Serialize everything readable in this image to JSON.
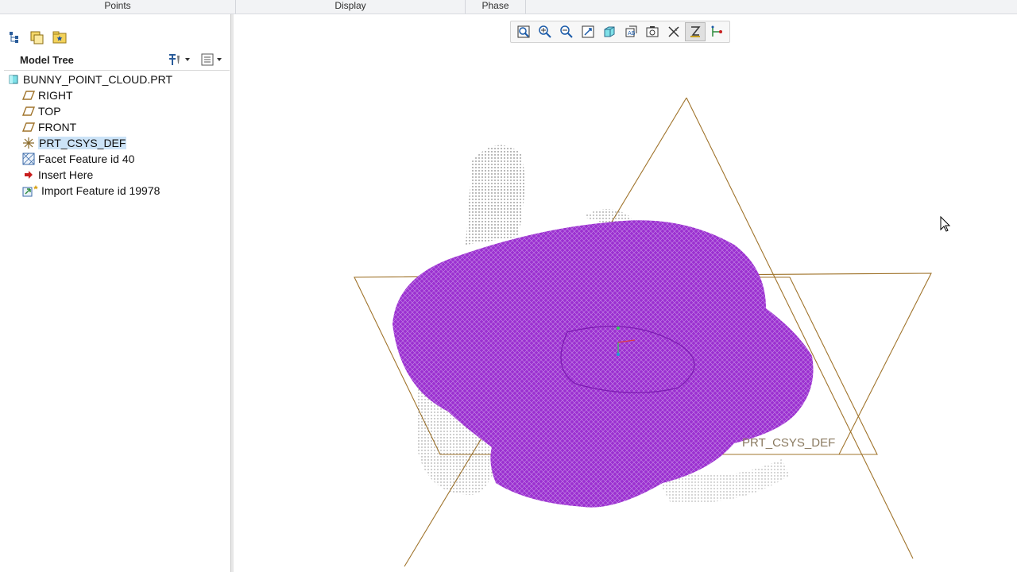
{
  "ribbon": {
    "groups": [
      "Points",
      "Display",
      "Phase"
    ]
  },
  "navigator": {
    "tab_icons": [
      "model-tree-tab-icon",
      "layers-tab-icon",
      "favorites-folder-tab-icon"
    ]
  },
  "model_tree": {
    "title": "Model Tree",
    "settings_icon": "tree-settings-icon",
    "show_icon": "tree-show-icon",
    "items": [
      {
        "label": "BUNNY_POINT_CLOUD.PRT",
        "icon": "part-icon",
        "indent": 0,
        "selected": false
      },
      {
        "label": "RIGHT",
        "icon": "datum-plane-icon",
        "indent": 1,
        "selected": false
      },
      {
        "label": "TOP",
        "icon": "datum-plane-icon",
        "indent": 1,
        "selected": false
      },
      {
        "label": "FRONT",
        "icon": "datum-plane-icon",
        "indent": 1,
        "selected": false
      },
      {
        "label": "PRT_CSYS_DEF",
        "icon": "csys-icon",
        "indent": 1,
        "selected": true
      },
      {
        "label": "Facet Feature id 40",
        "icon": "facet-feature-icon",
        "indent": 1,
        "selected": false
      },
      {
        "label": "Insert Here",
        "icon": "insert-arrow-icon",
        "indent": 1,
        "selected": false
      },
      {
        "label": "Import Feature id 19978",
        "icon": "import-feature-icon",
        "indent": 1,
        "selected": false
      }
    ]
  },
  "view_toolbar": {
    "buttons": [
      "refit-icon",
      "zoom-in-icon",
      "zoom-out-icon",
      "repaint-icon",
      "display-style-icon",
      "saved-views-icon",
      "view-manager-icon",
      "datum-display-icon",
      "spin-center-icon",
      "annotation-display-icon"
    ],
    "active_index": 8
  },
  "graphics": {
    "csys_label": "PRT_CSYS_DEF",
    "mesh_color": "#9b30d0",
    "datum_color": "#a0742c",
    "point_cloud_color": "#333333"
  }
}
